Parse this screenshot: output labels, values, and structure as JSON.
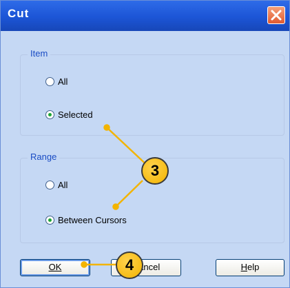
{
  "dialog": {
    "title": "Cut",
    "close_icon": "close-icon",
    "item_group": {
      "legend": "Item",
      "options": [
        {
          "label": "All",
          "checked": false
        },
        {
          "label": "Selected",
          "checked": true
        }
      ]
    },
    "range_group": {
      "legend": "Range",
      "options": [
        {
          "label": "All",
          "checked": false
        },
        {
          "label": "Between Cursors",
          "checked": true
        }
      ]
    },
    "buttons": {
      "ok": {
        "label": "OK",
        "accel": "O"
      },
      "cancel": {
        "label": "Cancel"
      },
      "help": {
        "label": "Help",
        "accel": "H"
      }
    }
  },
  "callouts": {
    "c3": "3",
    "c4": "4"
  },
  "colors": {
    "titlebar": "#1c55d6",
    "dialog_bg": "#c5d8f4",
    "legend_text": "#1a4cc4",
    "callout_fill": "#f3b400",
    "callout_line": "#f3b400",
    "close_button": "#e25a2f"
  }
}
